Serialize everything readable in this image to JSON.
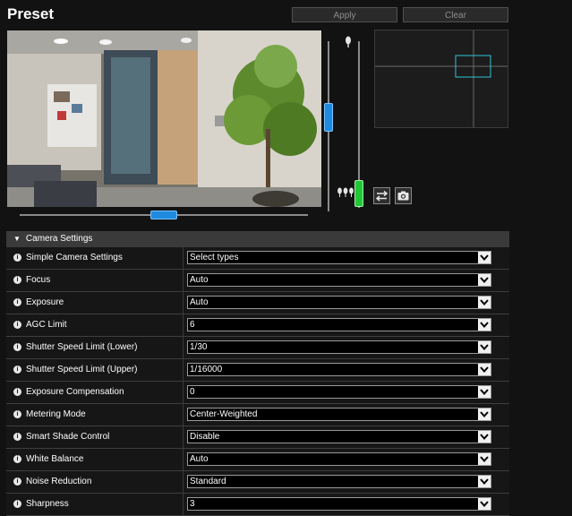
{
  "page": {
    "title": "Preset",
    "apply_label": "Apply",
    "clear_label": "Clear"
  },
  "camera_settings": {
    "header": "Camera Settings",
    "rows": [
      {
        "label": "Simple Camera Settings",
        "value": "Select types"
      },
      {
        "label": "Focus",
        "value": "Auto"
      },
      {
        "label": "Exposure",
        "value": "Auto"
      },
      {
        "label": "AGC Limit",
        "value": "6"
      },
      {
        "label": "Shutter Speed Limit (Lower)",
        "value": "1/30"
      },
      {
        "label": "Shutter Speed Limit (Upper)",
        "value": "1/16000"
      },
      {
        "label": "Exposure Compensation",
        "value": "0"
      },
      {
        "label": "Metering Mode",
        "value": "Center-Weighted"
      },
      {
        "label": "Smart Shade Control",
        "value": "Disable"
      },
      {
        "label": "White Balance",
        "value": "Auto"
      },
      {
        "label": "Noise Reduction",
        "value": "Standard"
      },
      {
        "label": "Sharpness",
        "value": "3"
      }
    ]
  },
  "colors": {
    "background": "#121212",
    "slider_blue": "#1e8be0",
    "slider_green": "#20c838",
    "minimap_frame": "#2ec4d6"
  },
  "icons": [
    "info-icon",
    "chevron-down-icon",
    "tree-single-icon",
    "tree-group-icon",
    "swap-arrows-icon",
    "camera-icon",
    "triangle-down-icon"
  ]
}
